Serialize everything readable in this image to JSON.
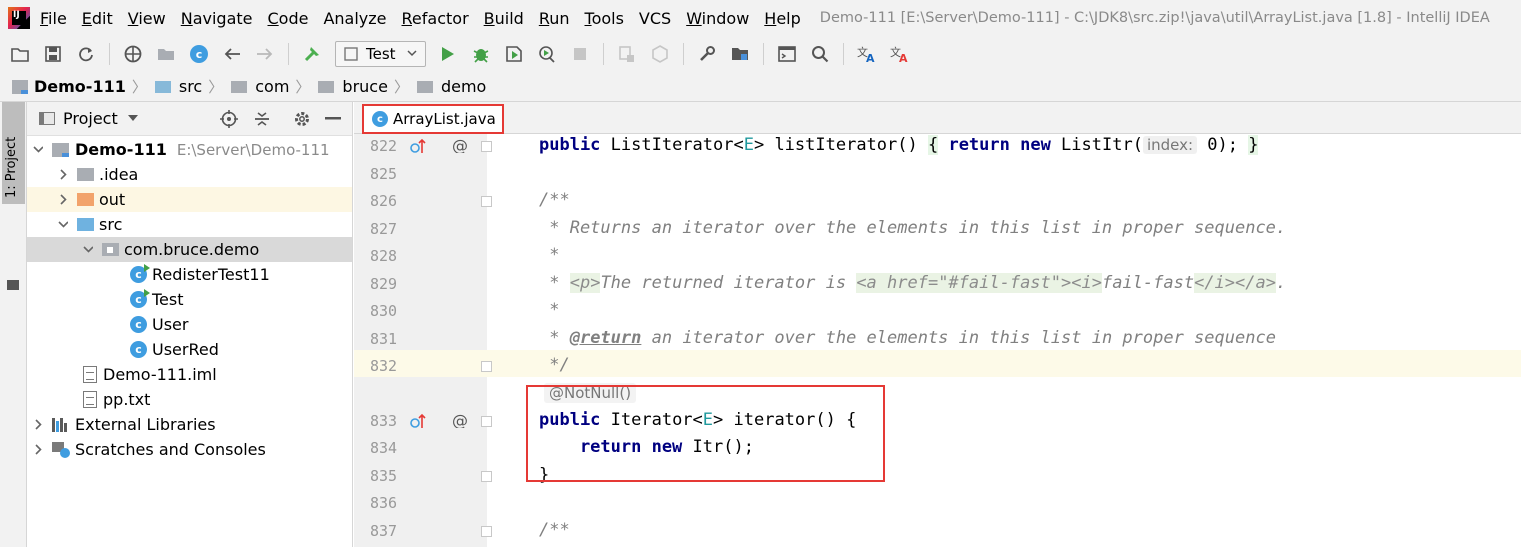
{
  "app": {
    "title": "Demo-111 [E:\\Server\\Demo-111] - C:\\JDK8\\src.zip!\\java\\util\\ArrayList.java [1.8] - IntelliJ IDEA",
    "logo_text": "IJ"
  },
  "menu": [
    {
      "mnemonic": "F",
      "rest": "ile"
    },
    {
      "mnemonic": "E",
      "rest": "dit"
    },
    {
      "mnemonic": "V",
      "rest": "iew"
    },
    {
      "mnemonic": "N",
      "rest": "avigate"
    },
    {
      "mnemonic": "C",
      "rest": "ode"
    },
    {
      "mnemonic": "",
      "rest": "Analyze"
    },
    {
      "mnemonic": "R",
      "rest": "efactor"
    },
    {
      "mnemonic": "B",
      "rest": "uild"
    },
    {
      "mnemonic": "R",
      "rest": "un"
    },
    {
      "mnemonic": "T",
      "rest": "ools"
    },
    {
      "mnemonic": "",
      "rest": "VCS"
    },
    {
      "mnemonic": "W",
      "rest": "indow"
    },
    {
      "mnemonic": "H",
      "rest": "elp"
    }
  ],
  "toolbar": {
    "run_config": "Test"
  },
  "breadcrumb": [
    "Demo-111",
    "src",
    "com",
    "bruce",
    "demo"
  ],
  "left_stripe": {
    "label": "1: Project"
  },
  "project": {
    "header": "Project",
    "tree": [
      {
        "label": "Demo-111",
        "path": "E:\\Server\\Demo-111",
        "bold": true
      },
      {
        "label": ".idea"
      },
      {
        "label": "out"
      },
      {
        "label": "src"
      },
      {
        "label": "com.bruce.demo"
      },
      {
        "label": "RedisterTest11"
      },
      {
        "label": "Test"
      },
      {
        "label": "User"
      },
      {
        "label": "UserRed"
      },
      {
        "label": "Demo-111.iml"
      },
      {
        "label": "pp.txt"
      },
      {
        "label": "External Libraries"
      },
      {
        "label": "Scratches and Consoles"
      }
    ]
  },
  "editor": {
    "tab": "ArrayList.java",
    "line_numbers": [
      "822",
      "825",
      "826",
      "827",
      "828",
      "829",
      "830",
      "831",
      "832",
      "833",
      "834",
      "835",
      "836",
      "837"
    ],
    "code": {
      "l822": {
        "a": "public ",
        "b": "ListIterator<",
        "c": "E",
        "d": "> listIterator() ",
        "e": "{",
        "f": " return new ",
        "g": "ListItr(",
        "hint": "index:",
        "h": " 0); ",
        "i": "}"
      },
      "l826": "/**",
      "l827": " * Returns an iterator over the elements in this list in proper sequence.",
      "l828": " *",
      "l829": {
        "a": " * ",
        "b": "<p>",
        "c": "The returned iterator is ",
        "d": "<a href=\"#fail-fast\"><i>",
        "e": "fail-fast",
        "f": "</i></a>",
        "g": "."
      },
      "l830": " *",
      "l831": {
        "a": " * ",
        "b": "@return",
        "c": " an iterator over the elements in this list in proper sequence"
      },
      "l832": " */",
      "annotation_hint": "@NotNull()",
      "l833": {
        "a": "public ",
        "b": "Iterator<",
        "c": "E",
        "d": "> iterator() {"
      },
      "l834": {
        "a": "    return new ",
        "b": "Itr();"
      },
      "l835": "}",
      "l837": "/**"
    }
  }
}
